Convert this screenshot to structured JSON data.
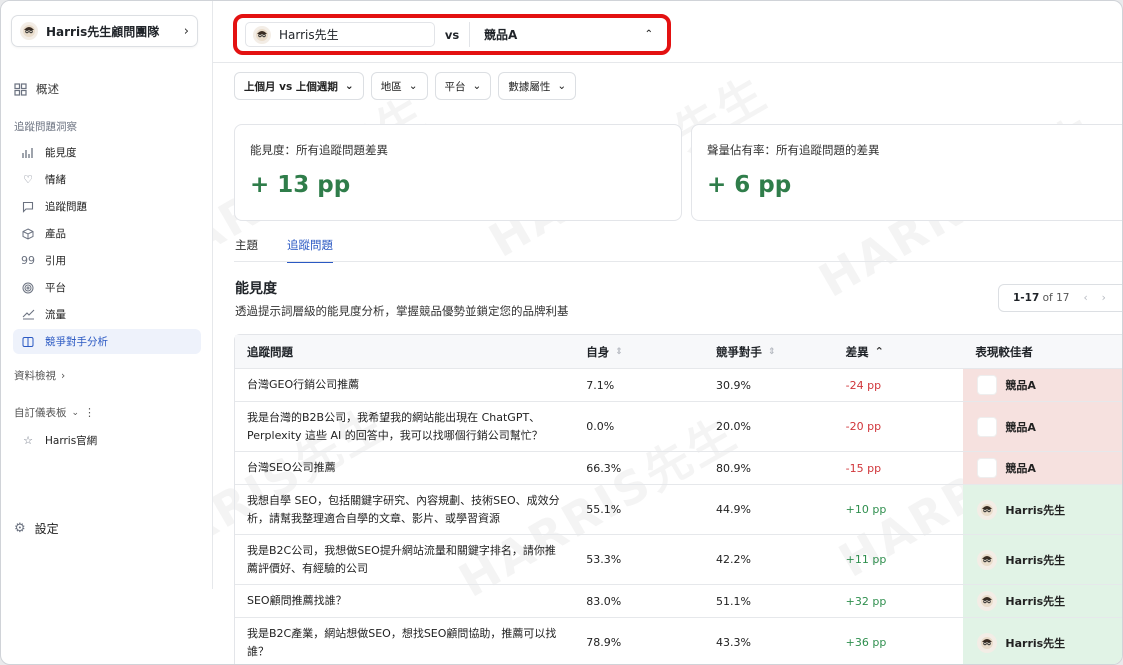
{
  "sidebar": {
    "team_name": "Harris先生顧問團隊",
    "overview": "概述",
    "section_tracking": "追蹤問題洞察",
    "items": [
      {
        "label": "能見度",
        "icon": "chart-icon"
      },
      {
        "label": "情緒",
        "icon": "heart-icon"
      },
      {
        "label": "追蹤問題",
        "icon": "chat-icon"
      },
      {
        "label": "產品",
        "icon": "cube-icon"
      },
      {
        "label": "引用",
        "icon": "quote-icon"
      },
      {
        "label": "平台",
        "icon": "target-icon"
      },
      {
        "label": "流量",
        "icon": "trend-icon"
      },
      {
        "label": "競爭對手分析",
        "icon": "compare-icon"
      }
    ],
    "data_view": "資料檢視",
    "custom_dashboards": "自訂儀表板",
    "dashboard_item": "Harris官網",
    "settings": "設定"
  },
  "compare": {
    "left": "Harris先生",
    "vs": "vs",
    "right": "競品A"
  },
  "filters": {
    "period": "上個月 vs 上個週期",
    "region": "地區",
    "platform": "平台",
    "attribute": "數據屬性"
  },
  "cards": {
    "visibility_label": "能見度：所有追蹤問題差異",
    "visibility_value": "+ 13 pp",
    "sov_label": "聲量佔有率：所有追蹤問題的差異",
    "sov_value": "+ 6 pp"
  },
  "tabs": [
    "主題",
    "追蹤問題"
  ],
  "section": {
    "title": "能見度",
    "desc": "透過提示詞層級的能見度分析，掌握競品優勢並鎖定您的品牌利基"
  },
  "pager": {
    "range": "1-17",
    "of": "of 17"
  },
  "table": {
    "headers": [
      "追蹤問題",
      "自身",
      "競爭對手",
      "差異",
      "表現較佳者"
    ],
    "rows": [
      {
        "q": "台灣GEO行銷公司推薦",
        "self": "7.1%",
        "comp": "30.9%",
        "diff": "-24 pp",
        "winner": "競品A",
        "w": "competitor"
      },
      {
        "q": "我是台灣的B2B公司，我希望我的網站能出現在 ChatGPT、Perplexity 這些 AI 的回答中，我可以找哪個行銷公司幫忙？",
        "self": "0.0%",
        "comp": "20.0%",
        "diff": "-20 pp",
        "winner": "競品A",
        "w": "competitor"
      },
      {
        "q": "台灣SEO公司推薦",
        "self": "66.3%",
        "comp": "80.9%",
        "diff": "-15 pp",
        "winner": "競品A",
        "w": "competitor"
      },
      {
        "q": "我想自學 SEO，包括關鍵字研究、內容規劃、技術SEO、成效分析，請幫我整理適合自學的文章、影片、或學習資源",
        "self": "55.1%",
        "comp": "44.9%",
        "diff": "+10 pp",
        "winner": "Harris先生",
        "w": "self"
      },
      {
        "q": "我是B2C公司，我想做SEO提升網站流量和關鍵字排名，請你推薦評價好、有經驗的公司",
        "self": "53.3%",
        "comp": "42.2%",
        "diff": "+11 pp",
        "winner": "Harris先生",
        "w": "self"
      },
      {
        "q": "SEO顧問推薦找誰？",
        "self": "83.0%",
        "comp": "51.1%",
        "diff": "+32 pp",
        "winner": "Harris先生",
        "w": "self"
      },
      {
        "q": "我是B2C產業，網站想做SEO，想找SEO顧問協助，推薦可以找誰？",
        "self": "78.9%",
        "comp": "43.3%",
        "diff": "+36 pp",
        "winner": "Harris先生",
        "w": "self"
      }
    ]
  }
}
